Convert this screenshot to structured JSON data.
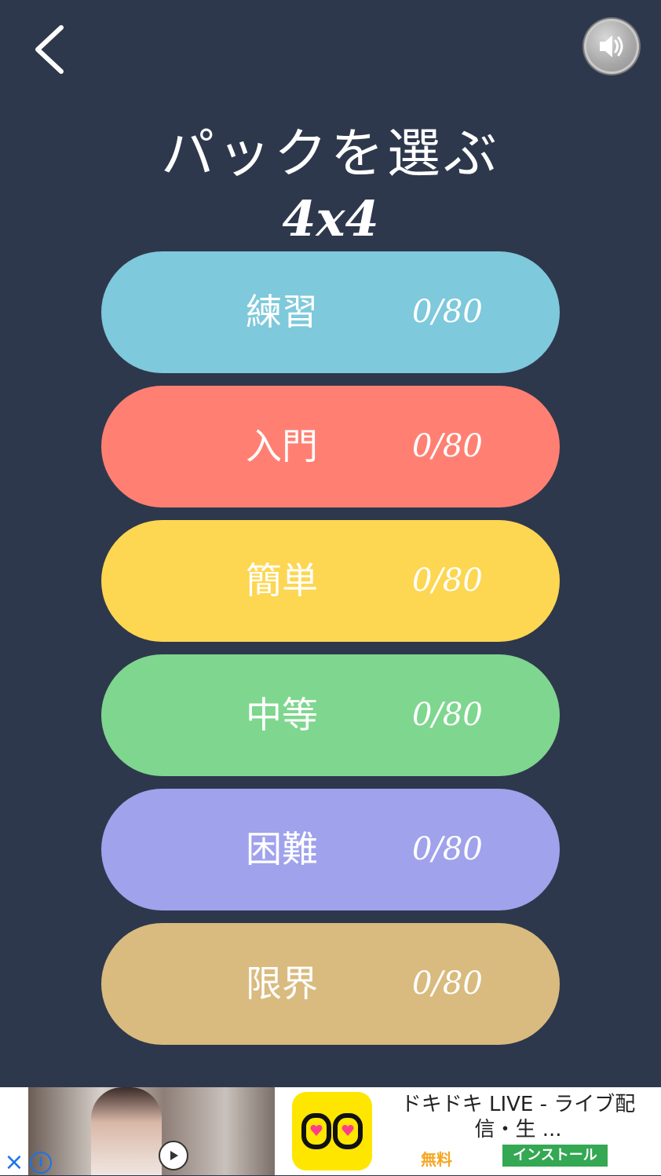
{
  "header": {
    "back_icon": "chevron-left-icon",
    "sound_icon": "speaker-on-icon",
    "title": "パックを選ぶ",
    "pack_size": "4x4"
  },
  "packs": [
    {
      "name": "練習",
      "progress": "0/80",
      "color": "#7ec9db"
    },
    {
      "name": "入門",
      "progress": "0/80",
      "color": "#ff8073"
    },
    {
      "name": "簡単",
      "progress": "0/80",
      "color": "#fdd652"
    },
    {
      "name": "中等",
      "progress": "0/80",
      "color": "#7fd68f"
    },
    {
      "name": "困難",
      "progress": "0/80",
      "color": "#a0a2ec"
    },
    {
      "name": "限界",
      "progress": "0/80",
      "color": "#d9bb7f"
    }
  ],
  "ad": {
    "close_icon": "close-icon",
    "info_icon": "info-icon",
    "app_name": "ドキドキ LIVE - ライブ配信・生 ...",
    "price": "無料",
    "install_label": "インストール",
    "app_icon": "dokidoki-app-icon",
    "play_icon": "play-icon"
  }
}
